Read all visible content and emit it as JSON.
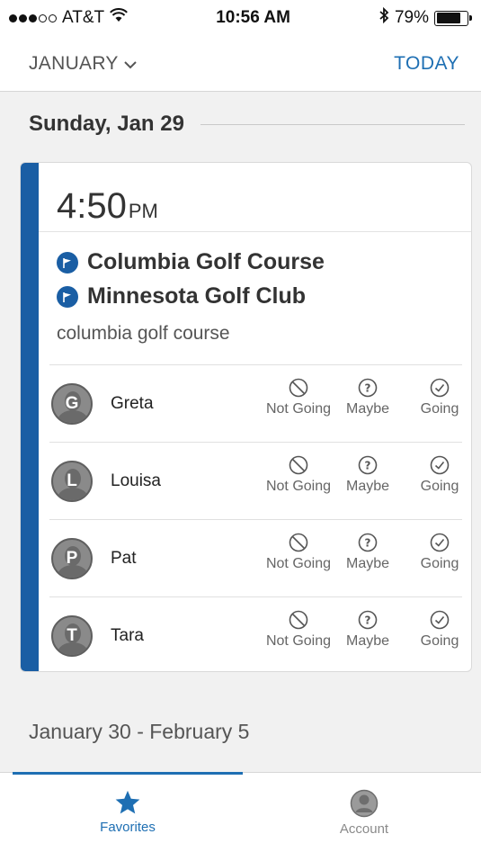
{
  "status_bar": {
    "carrier": "AT&T",
    "time": "10:56 AM",
    "battery": "79%",
    "battery_level": 0.79,
    "signal_bars": 3,
    "signal_total": 5
  },
  "header": {
    "month": "JANUARY",
    "today": "TODAY"
  },
  "day": {
    "label": "Sunday, Jan 29"
  },
  "event": {
    "time": "4:50",
    "ampm": "PM",
    "locations": [
      "Columbia Golf Course",
      "Minnesota Golf Club"
    ],
    "note": "columbia golf course",
    "accent_color": "#1a5ea4",
    "attendees": [
      {
        "initial": "G",
        "name": "Greta"
      },
      {
        "initial": "L",
        "name": "Louisa"
      },
      {
        "initial": "P",
        "name": "Pat"
      },
      {
        "initial": "T",
        "name": "Tara"
      }
    ],
    "rsvp_labels": {
      "not_going": "Not Going",
      "maybe": "Maybe",
      "going": "Going"
    }
  },
  "next_week": {
    "label": "January 30 - February 5"
  },
  "tabs": {
    "favorites": "Favorites",
    "account": "Account",
    "active_color": "#1e6fb3"
  }
}
